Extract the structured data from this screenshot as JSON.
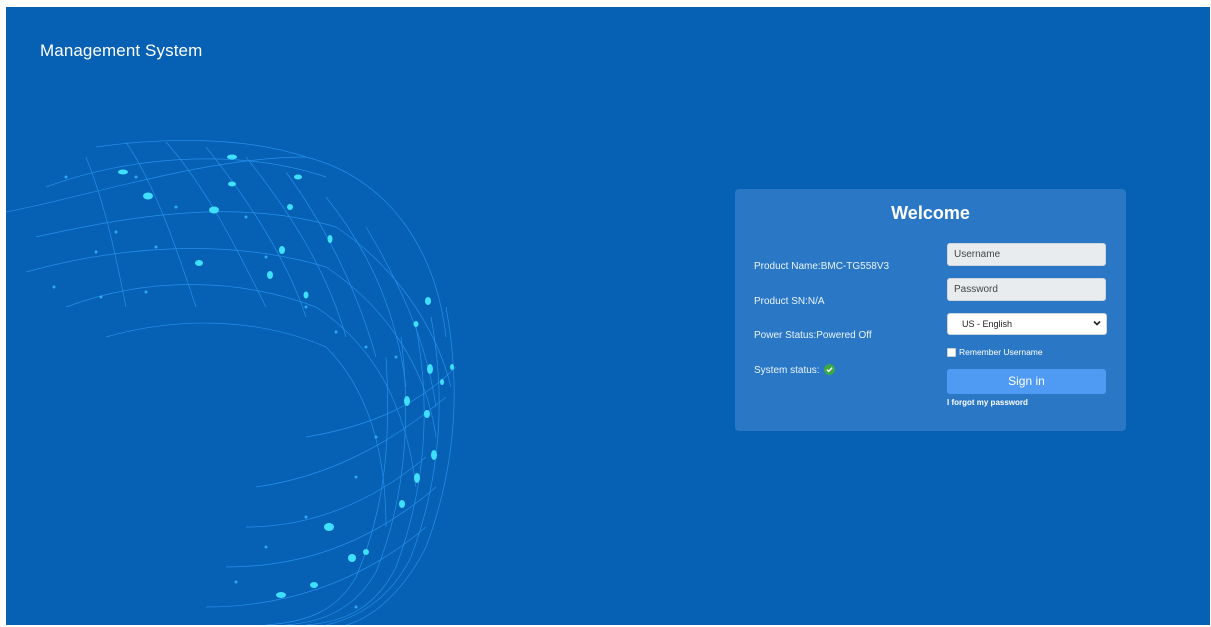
{
  "header": {
    "title": "Management System"
  },
  "login": {
    "heading": "Welcome",
    "info": {
      "product_name": "Product Name:BMC-TG558V3",
      "product_sn": "Product SN:N/A",
      "power_status": "Power Status:Powered Off",
      "system_status_label": "System status:"
    },
    "username_placeholder": "Username",
    "password_placeholder": "Password",
    "language": {
      "selected": "US - English"
    },
    "remember_label": "Remember Username",
    "remember_checked": false,
    "signin_label": "Sign in",
    "forgot_label": "I forgot my password"
  },
  "colors": {
    "background": "#0660b3",
    "panel": "#2a78c5",
    "button": "#4f9bf4",
    "status_ok": "#3aa845"
  }
}
